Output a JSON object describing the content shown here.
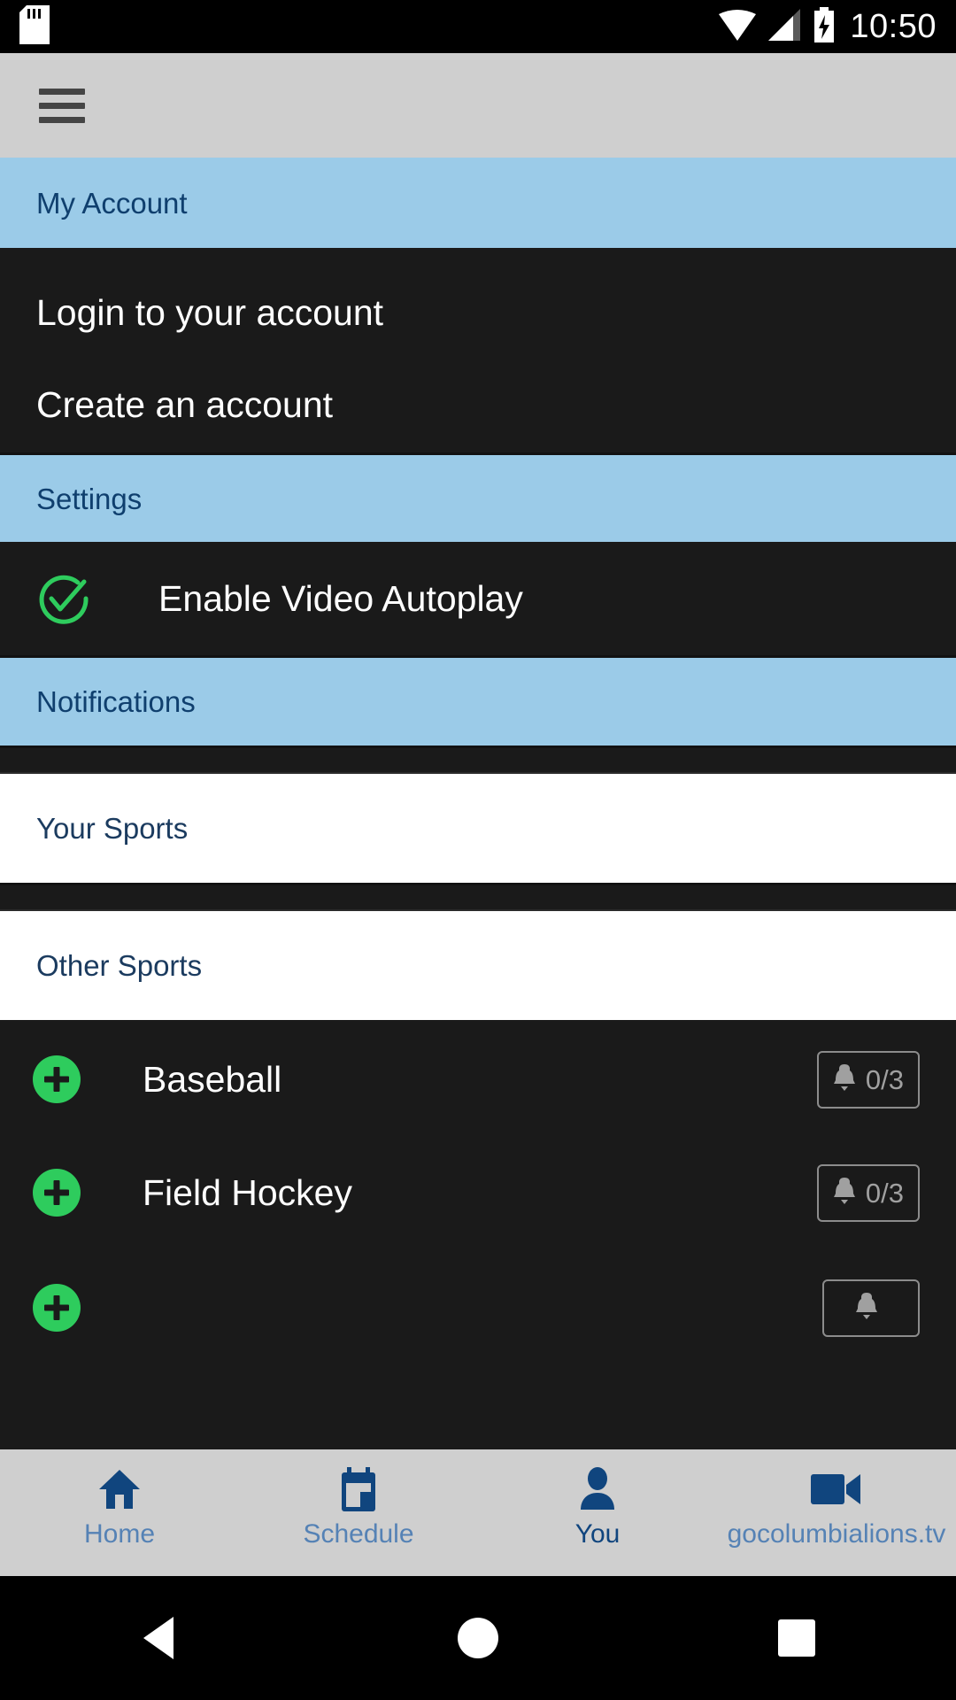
{
  "status_bar": {
    "time": "10:50",
    "icons": [
      "sd-card-icon",
      "wifi-icon",
      "cellular-signal-icon",
      "battery-charging-icon"
    ]
  },
  "app_bar": {
    "menu_icon": "hamburger-menu-icon"
  },
  "sections": {
    "my_account": {
      "title": "My Account",
      "items": [
        {
          "label": "Login to your account"
        },
        {
          "label": "Create an account"
        }
      ]
    },
    "settings": {
      "title": "Settings",
      "autoplay": {
        "label": "Enable Video Autoplay",
        "icon": "check-circle-icon",
        "checked": true
      }
    },
    "notifications": {
      "title": "Notifications",
      "your_sports": {
        "title": "Your Sports"
      },
      "other_sports": {
        "title": "Other Sports",
        "sports": [
          {
            "name": "Baseball",
            "add_icon": "plus-circle-icon",
            "bell_icon": "bell-icon",
            "count": "0/3"
          },
          {
            "name": "Field Hockey",
            "add_icon": "plus-circle-icon",
            "bell_icon": "bell-icon",
            "count": "0/3"
          },
          {
            "name": "",
            "add_icon": "plus-circle-icon",
            "bell_icon": "bell-icon",
            "count": ""
          }
        ]
      }
    }
  },
  "bottom_nav": {
    "items": [
      {
        "label": "Home",
        "icon": "home-icon",
        "active": false
      },
      {
        "label": "Schedule",
        "icon": "calendar-icon",
        "active": false
      },
      {
        "label": "You",
        "icon": "person-icon",
        "active": true
      },
      {
        "label": "gocolumbialions.tv",
        "icon": "video-camera-icon",
        "active": false
      }
    ]
  },
  "system_nav": {
    "back": "back-triangle-icon",
    "home": "home-circle-icon",
    "recents": "recents-square-icon"
  },
  "colors": {
    "accent_blue": "#9bcbe8",
    "header_text": "#0f3f6e",
    "surface_dark": "#1a1a1a",
    "green": "#2ecc5d",
    "nav_blue": "#10457e",
    "nav_label": "#5582b5"
  }
}
